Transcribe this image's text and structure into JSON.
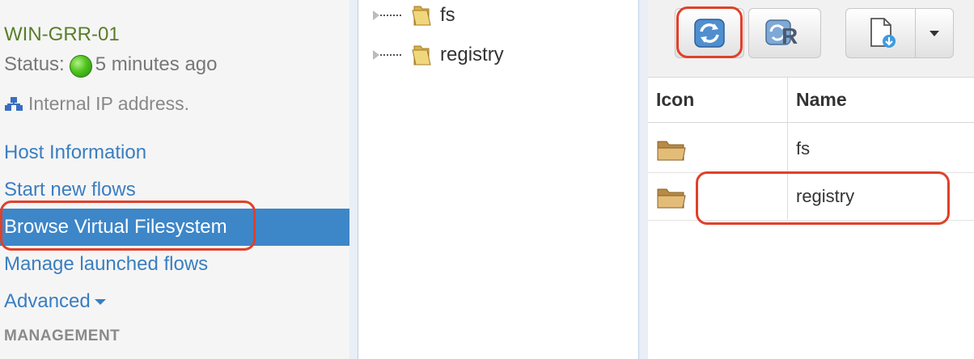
{
  "sidebar": {
    "host_name": "WIN-GRR-01",
    "status_label": "Status:",
    "status_text": "5 minutes ago",
    "ip_text": "Internal IP address.",
    "nav": [
      {
        "label": "Host Information",
        "active": false
      },
      {
        "label": "Start new flows",
        "active": false
      },
      {
        "label": "Browse Virtual Filesystem",
        "active": true
      },
      {
        "label": "Manage launched flows",
        "active": false
      },
      {
        "label": "Advanced",
        "active": false
      }
    ],
    "section_header": "MANAGEMENT"
  },
  "tree": {
    "nodes": [
      {
        "label": "fs",
        "icon": "folder-icon"
      },
      {
        "label": "registry",
        "icon": "folder-icon"
      }
    ]
  },
  "toolbar": {
    "buttons": [
      {
        "name": "refresh-button",
        "icon": "refresh-icon"
      },
      {
        "name": "recursive-refresh-button",
        "icon": "recursive-refresh-icon"
      },
      {
        "name": "download-button",
        "icon": "download-file-icon"
      },
      {
        "name": "download-menu-button",
        "icon": "caret-down-icon"
      }
    ]
  },
  "grid": {
    "columns": [
      "Icon",
      "Name"
    ],
    "rows": [
      {
        "icon": "folder-icon",
        "name": "fs"
      },
      {
        "icon": "folder-icon",
        "name": "registry"
      }
    ]
  },
  "colors": {
    "accent": "#3d86c8",
    "link": "#3a7ec1",
    "host_name": "#5a7d2a",
    "highlight": "#e0402a"
  }
}
